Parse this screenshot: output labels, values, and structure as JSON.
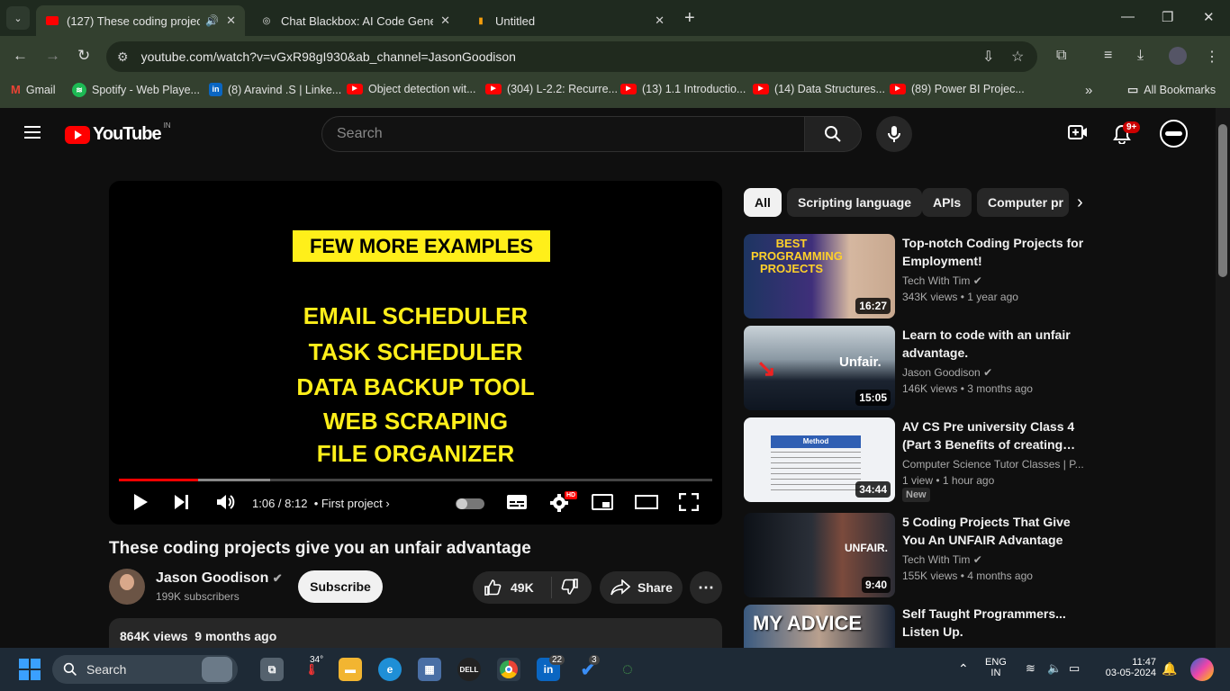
{
  "browser": {
    "tabs": [
      {
        "title": "(127) These coding projects",
        "icon": "youtube-icon"
      },
      {
        "title": "Chat Blackbox: AI Code Generat",
        "icon": "blackbox-icon"
      },
      {
        "title": "Untitled",
        "icon": "doc-icon"
      }
    ],
    "url_site": "⚙",
    "url": "youtube.com/watch?v=vGxR98gI930&ab_channel=JasonGoodison",
    "bookmarks": [
      {
        "label": "Gmail",
        "icon": "gmail-icon"
      },
      {
        "label": "Spotify - Web Playe...",
        "icon": "spotify-icon"
      },
      {
        "label": "(8) Aravind .S | Linke...",
        "icon": "linkedin-icon"
      },
      {
        "label": "Object detection wit...",
        "icon": "youtube-icon"
      },
      {
        "label": "(304) L-2.2: Recurre...",
        "icon": "youtube-icon"
      },
      {
        "label": "(13) 1.1 Introductio...",
        "icon": "youtube-icon"
      },
      {
        "label": "(14) Data Structures...",
        "icon": "youtube-icon"
      },
      {
        "label": "(89) Power BI Projec...",
        "icon": "youtube-icon"
      }
    ],
    "all_bookmarks": "All Bookmarks",
    "more": "»"
  },
  "youtube": {
    "logo": "YouTube",
    "country": "IN",
    "search_placeholder": "Search",
    "notif_count": "9+"
  },
  "video": {
    "banner": "FEW MORE EXAMPLES",
    "lines": [
      "EMAIL SCHEDULER",
      "TASK SCHEDULER",
      "DATA BACKUP TOOL",
      "WEB SCRAPING",
      "FILE ORGANIZER"
    ],
    "time": "1:06 / 8:12",
    "chapter": "• First project",
    "hd": "HD",
    "progress": 0.134
  },
  "info": {
    "title": "These coding projects give you an unfair advantage",
    "channel": "Jason Goodison",
    "subscribers": "199K subscribers",
    "subscribe": "Subscribe",
    "likes": "49K",
    "share": "Share",
    "views": "864K views",
    "date": "9 months ago"
  },
  "chips": [
    "All",
    "Scripting language",
    "APIs",
    "Computer pr"
  ],
  "recs": [
    {
      "title": "Top-notch Coding Projects for Employment!",
      "channel": "Tech With Tim",
      "verified": true,
      "meta": "343K views  • 1 year ago",
      "duration": "16:27",
      "thumb_text": "BEST PROGRAMMING PROJECTS"
    },
    {
      "title": "Learn to code with an unfair advantage.",
      "channel": "Jason Goodison",
      "verified": true,
      "meta": "146K views  • 3 months ago",
      "duration": "15:05",
      "thumb_text": "Unfair."
    },
    {
      "title": "AV CS Pre university Class 4 (Part 3 Benefits of creating…",
      "channel": "Computer Science Tutor Classes | P...",
      "verified": false,
      "meta": "1 view  • 1 hour ago",
      "duration": "34:44",
      "badge": "New",
      "thumb_text": "Method"
    },
    {
      "title": "5 Coding Projects That Give You An UNFAIR Advantage",
      "channel": "Tech With Tim",
      "verified": true,
      "meta": "155K views  • 4 months ago",
      "duration": "9:40",
      "thumb_text": "UNFAIR."
    },
    {
      "title": "Self Taught Programmers... Listen Up.",
      "channel": "",
      "verified": false,
      "meta": "",
      "duration": "",
      "thumb_text": "MY ADVICE"
    }
  ],
  "taskbar": {
    "search": "Search",
    "weather": "34°",
    "lang1": "ENG",
    "lang2": "IN",
    "time": "11:47",
    "date": "03-05-2024",
    "linkedin_badge": "22",
    "todo_badge": "3"
  }
}
